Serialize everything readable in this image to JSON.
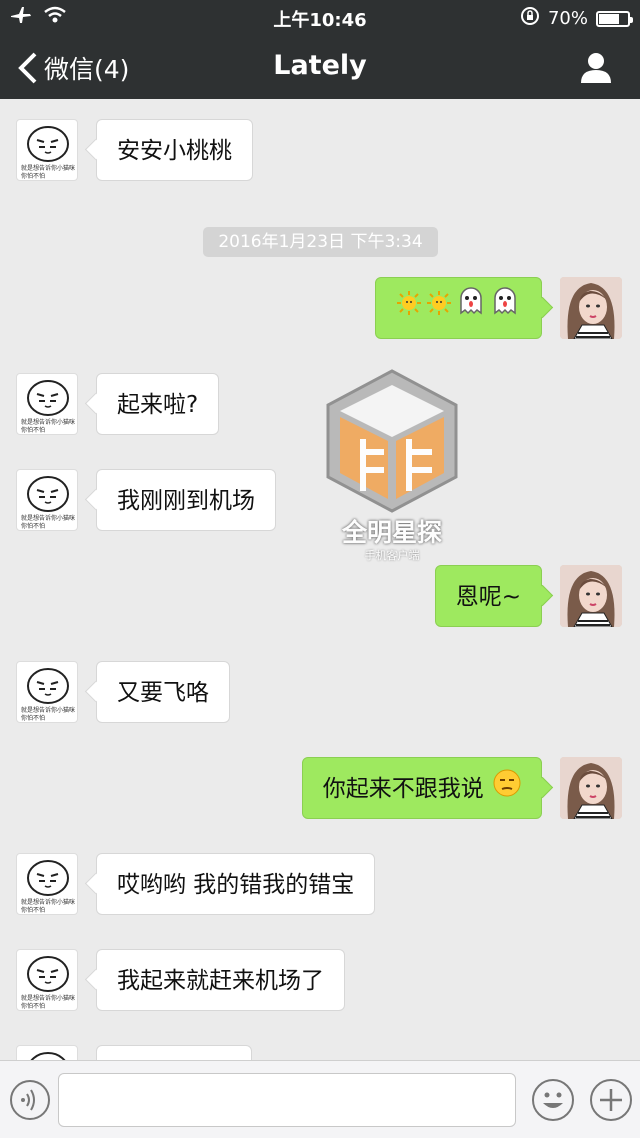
{
  "status_bar": {
    "time": "上午10:46",
    "battery_percent": "70%",
    "battery_level": 0.7,
    "icons": [
      "airplane-icon",
      "wifi-icon",
      "rotation-lock-icon",
      "battery-icon"
    ]
  },
  "nav": {
    "back_label": "微信(4)",
    "title": "Lately",
    "profile_icon": "person-icon"
  },
  "chat": {
    "timestamp": "2016年1月23日 下午3:34",
    "messages": [
      {
        "sender": "other",
        "text": "安安小桃桃"
      },
      {
        "sender": "me",
        "text": "",
        "emojis": [
          "sun-emoji",
          "sun-emoji",
          "ghost-emoji",
          "ghost-emoji"
        ]
      },
      {
        "sender": "other",
        "text": "起来啦?"
      },
      {
        "sender": "other",
        "text": "我刚刚到机场"
      },
      {
        "sender": "me",
        "text": "恩呢~"
      },
      {
        "sender": "other",
        "text": "又要飞咯"
      },
      {
        "sender": "me",
        "text": "你起来不跟我说",
        "emojis": [
          "unamused-face-emoji"
        ]
      },
      {
        "sender": "other",
        "text": "哎哟哟 我的错我的错宝"
      },
      {
        "sender": "other",
        "text": "我起来就赶来机场了"
      }
    ],
    "avatar_other_caption": "就是想告诉你小猫咪你怕不怕",
    "watermark": {
      "title": "全明星探",
      "subtitle": "手机客户端"
    }
  },
  "toolbar": {
    "voice_icon": "voice-icon",
    "emoji_icon": "emoji-icon",
    "plus_icon": "plus-icon",
    "input_value": ""
  },
  "colors": {
    "bar": "#2e3132",
    "bubble_me": "#9ee95f",
    "bubble_other": "#ffffff",
    "background": "#ebebeb"
  }
}
